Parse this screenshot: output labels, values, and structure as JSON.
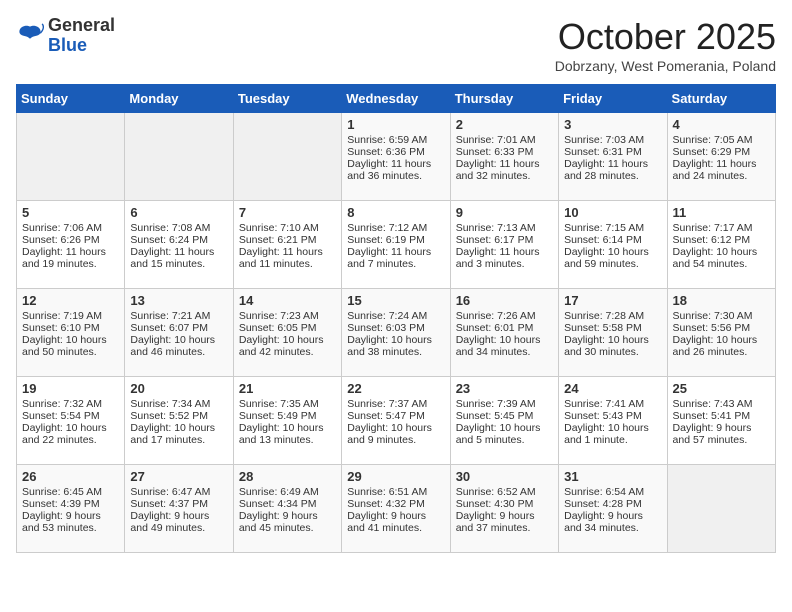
{
  "header": {
    "logo": {
      "general": "General",
      "blue": "Blue"
    },
    "title": "October 2025",
    "subtitle": "Dobrzany, West Pomerania, Poland"
  },
  "weekdays": [
    "Sunday",
    "Monday",
    "Tuesday",
    "Wednesday",
    "Thursday",
    "Friday",
    "Saturday"
  ],
  "weeks": [
    [
      {
        "day": "",
        "content": ""
      },
      {
        "day": "",
        "content": ""
      },
      {
        "day": "",
        "content": ""
      },
      {
        "day": "1",
        "content": "Sunrise: 6:59 AM\nSunset: 6:36 PM\nDaylight: 11 hours\nand 36 minutes."
      },
      {
        "day": "2",
        "content": "Sunrise: 7:01 AM\nSunset: 6:33 PM\nDaylight: 11 hours\nand 32 minutes."
      },
      {
        "day": "3",
        "content": "Sunrise: 7:03 AM\nSunset: 6:31 PM\nDaylight: 11 hours\nand 28 minutes."
      },
      {
        "day": "4",
        "content": "Sunrise: 7:05 AM\nSunset: 6:29 PM\nDaylight: 11 hours\nand 24 minutes."
      }
    ],
    [
      {
        "day": "5",
        "content": "Sunrise: 7:06 AM\nSunset: 6:26 PM\nDaylight: 11 hours\nand 19 minutes."
      },
      {
        "day": "6",
        "content": "Sunrise: 7:08 AM\nSunset: 6:24 PM\nDaylight: 11 hours\nand 15 minutes."
      },
      {
        "day": "7",
        "content": "Sunrise: 7:10 AM\nSunset: 6:21 PM\nDaylight: 11 hours\nand 11 minutes."
      },
      {
        "day": "8",
        "content": "Sunrise: 7:12 AM\nSunset: 6:19 PM\nDaylight: 11 hours\nand 7 minutes."
      },
      {
        "day": "9",
        "content": "Sunrise: 7:13 AM\nSunset: 6:17 PM\nDaylight: 11 hours\nand 3 minutes."
      },
      {
        "day": "10",
        "content": "Sunrise: 7:15 AM\nSunset: 6:14 PM\nDaylight: 10 hours\nand 59 minutes."
      },
      {
        "day": "11",
        "content": "Sunrise: 7:17 AM\nSunset: 6:12 PM\nDaylight: 10 hours\nand 54 minutes."
      }
    ],
    [
      {
        "day": "12",
        "content": "Sunrise: 7:19 AM\nSunset: 6:10 PM\nDaylight: 10 hours\nand 50 minutes."
      },
      {
        "day": "13",
        "content": "Sunrise: 7:21 AM\nSunset: 6:07 PM\nDaylight: 10 hours\nand 46 minutes."
      },
      {
        "day": "14",
        "content": "Sunrise: 7:23 AM\nSunset: 6:05 PM\nDaylight: 10 hours\nand 42 minutes."
      },
      {
        "day": "15",
        "content": "Sunrise: 7:24 AM\nSunset: 6:03 PM\nDaylight: 10 hours\nand 38 minutes."
      },
      {
        "day": "16",
        "content": "Sunrise: 7:26 AM\nSunset: 6:01 PM\nDaylight: 10 hours\nand 34 minutes."
      },
      {
        "day": "17",
        "content": "Sunrise: 7:28 AM\nSunset: 5:58 PM\nDaylight: 10 hours\nand 30 minutes."
      },
      {
        "day": "18",
        "content": "Sunrise: 7:30 AM\nSunset: 5:56 PM\nDaylight: 10 hours\nand 26 minutes."
      }
    ],
    [
      {
        "day": "19",
        "content": "Sunrise: 7:32 AM\nSunset: 5:54 PM\nDaylight: 10 hours\nand 22 minutes."
      },
      {
        "day": "20",
        "content": "Sunrise: 7:34 AM\nSunset: 5:52 PM\nDaylight: 10 hours\nand 17 minutes."
      },
      {
        "day": "21",
        "content": "Sunrise: 7:35 AM\nSunset: 5:49 PM\nDaylight: 10 hours\nand 13 minutes."
      },
      {
        "day": "22",
        "content": "Sunrise: 7:37 AM\nSunset: 5:47 PM\nDaylight: 10 hours\nand 9 minutes."
      },
      {
        "day": "23",
        "content": "Sunrise: 7:39 AM\nSunset: 5:45 PM\nDaylight: 10 hours\nand 5 minutes."
      },
      {
        "day": "24",
        "content": "Sunrise: 7:41 AM\nSunset: 5:43 PM\nDaylight: 10 hours\nand 1 minute."
      },
      {
        "day": "25",
        "content": "Sunrise: 7:43 AM\nSunset: 5:41 PM\nDaylight: 9 hours\nand 57 minutes."
      }
    ],
    [
      {
        "day": "26",
        "content": "Sunrise: 6:45 AM\nSunset: 4:39 PM\nDaylight: 9 hours\nand 53 minutes."
      },
      {
        "day": "27",
        "content": "Sunrise: 6:47 AM\nSunset: 4:37 PM\nDaylight: 9 hours\nand 49 minutes."
      },
      {
        "day": "28",
        "content": "Sunrise: 6:49 AM\nSunset: 4:34 PM\nDaylight: 9 hours\nand 45 minutes."
      },
      {
        "day": "29",
        "content": "Sunrise: 6:51 AM\nSunset: 4:32 PM\nDaylight: 9 hours\nand 41 minutes."
      },
      {
        "day": "30",
        "content": "Sunrise: 6:52 AM\nSunset: 4:30 PM\nDaylight: 9 hours\nand 37 minutes."
      },
      {
        "day": "31",
        "content": "Sunrise: 6:54 AM\nSunset: 4:28 PM\nDaylight: 9 hours\nand 34 minutes."
      },
      {
        "day": "",
        "content": ""
      }
    ]
  ]
}
